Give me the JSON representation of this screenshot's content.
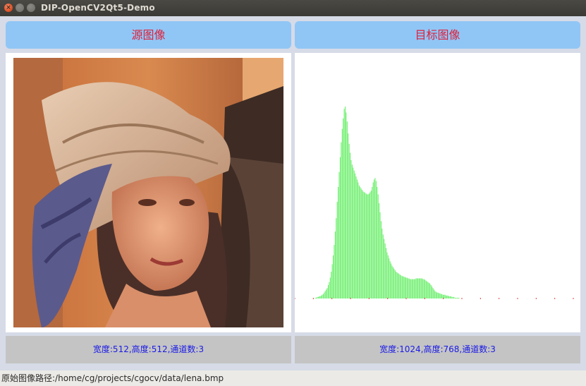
{
  "window": {
    "title": "DIP-OpenCV2Qt5-Demo"
  },
  "left_panel": {
    "header": "源图像",
    "footer": "宽度:512,高度:512,通道数:3",
    "image_icon": "portrait-photo"
  },
  "right_panel": {
    "header": "目标图像",
    "footer": "宽度:1024,高度:768,通道数:3"
  },
  "status_bar": {
    "text": "原始图像路径:/home/cg/projects/cgocv/data/lena.bmp"
  },
  "colors": {
    "header_bg": "#90c6f6",
    "header_text": "#e0203a",
    "footer_bg": "#c4c4c4",
    "footer_text": "#1a1ae6",
    "histogram_bar": "#66ee66"
  },
  "chart_data": {
    "type": "bar",
    "x_range": [
      0,
      255
    ],
    "values": [
      0,
      0,
      0,
      0,
      0,
      0,
      0,
      0,
      0,
      0,
      0,
      0,
      0,
      0,
      0,
      0,
      0,
      0,
      0,
      0,
      1,
      1,
      2,
      2,
      3,
      3,
      4,
      5,
      6,
      8,
      10,
      12,
      14,
      18,
      22,
      28,
      36,
      46,
      58,
      72,
      90,
      108,
      130,
      150,
      170,
      190,
      210,
      228,
      242,
      255,
      258,
      250,
      238,
      222,
      208,
      196,
      186,
      180,
      176,
      172,
      168,
      164,
      160,
      156,
      152,
      150,
      148,
      146,
      144,
      143,
      142,
      141,
      140,
      140,
      141,
      143,
      145,
      150,
      156,
      160,
      162,
      158,
      150,
      140,
      128,
      116,
      104,
      94,
      86,
      80,
      74,
      68,
      62,
      58,
      54,
      50,
      47,
      44,
      42,
      40,
      38,
      36,
      35,
      34,
      33,
      32,
      31,
      30,
      30,
      29,
      29,
      28,
      28,
      27,
      27,
      26,
      26,
      26,
      26,
      26,
      26,
      27,
      27,
      27,
      27,
      27,
      27,
      27,
      26,
      26,
      25,
      24,
      23,
      22,
      21,
      20,
      18,
      16,
      14,
      12,
      10,
      9,
      8,
      8,
      7,
      7,
      6,
      6,
      5,
      5,
      5,
      4,
      4,
      4,
      3,
      3,
      3,
      2,
      2,
      2,
      1,
      1,
      1,
      1,
      1,
      0,
      0,
      0,
      0,
      0,
      0,
      0,
      0,
      0,
      0,
      0,
      0,
      0,
      0,
      0,
      0,
      0,
      0,
      0,
      0,
      0,
      0,
      0,
      0,
      0,
      0,
      0,
      0,
      0,
      0,
      0,
      0,
      0,
      0,
      0,
      0,
      0,
      0,
      0,
      0,
      0,
      0,
      0,
      0,
      0,
      0,
      0,
      0,
      0,
      0,
      0,
      0,
      0,
      0,
      0,
      0,
      0,
      0,
      0,
      0,
      0,
      0,
      0,
      0,
      0,
      0,
      0,
      0,
      0,
      0,
      0,
      0,
      0,
      0,
      0,
      0,
      0,
      0,
      0,
      0,
      0,
      0,
      0,
      0,
      0,
      0,
      0,
      0,
      0,
      0,
      0,
      0,
      0,
      0,
      0,
      0,
      0,
      0,
      0,
      0,
      0,
      0,
      0,
      0,
      0,
      0,
      0,
      0,
      0,
      0,
      0,
      0,
      0,
      0
    ],
    "xlabel": "",
    "ylabel": "",
    "grid": false
  }
}
